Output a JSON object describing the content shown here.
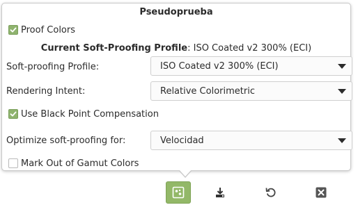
{
  "popover": {
    "title": "Pseudoprueba",
    "proof_colors": {
      "label": "Proof Colors",
      "checked": true
    },
    "current_profile": {
      "label": "Current Soft-Proofing Profile",
      "value": "ISO Coated v2 300% (ECI)"
    },
    "soft_proofing_profile": {
      "label": "Soft-proofing Profile:",
      "value": "ISO Coated v2 300% (ECI)"
    },
    "rendering_intent": {
      "label": "Rendering Intent:",
      "value": "Relative Colorimetric"
    },
    "black_point": {
      "label": "Use Black Point Compensation",
      "checked": true
    },
    "optimize": {
      "label": "Optimize soft-proofing for:",
      "value": "Velocidad"
    },
    "gamut": {
      "label": "Mark Out of Gamut Colors",
      "checked": false
    }
  },
  "toolbar": {
    "buttons": [
      {
        "icon": "soft-proof-icon",
        "active": true
      },
      {
        "icon": "export-icon",
        "active": false
      },
      {
        "icon": "reset-icon",
        "active": false
      },
      {
        "icon": "close-icon",
        "active": false
      }
    ]
  },
  "colors": {
    "accent": "#93b868",
    "checkbox_checked": "#8fb36e"
  }
}
